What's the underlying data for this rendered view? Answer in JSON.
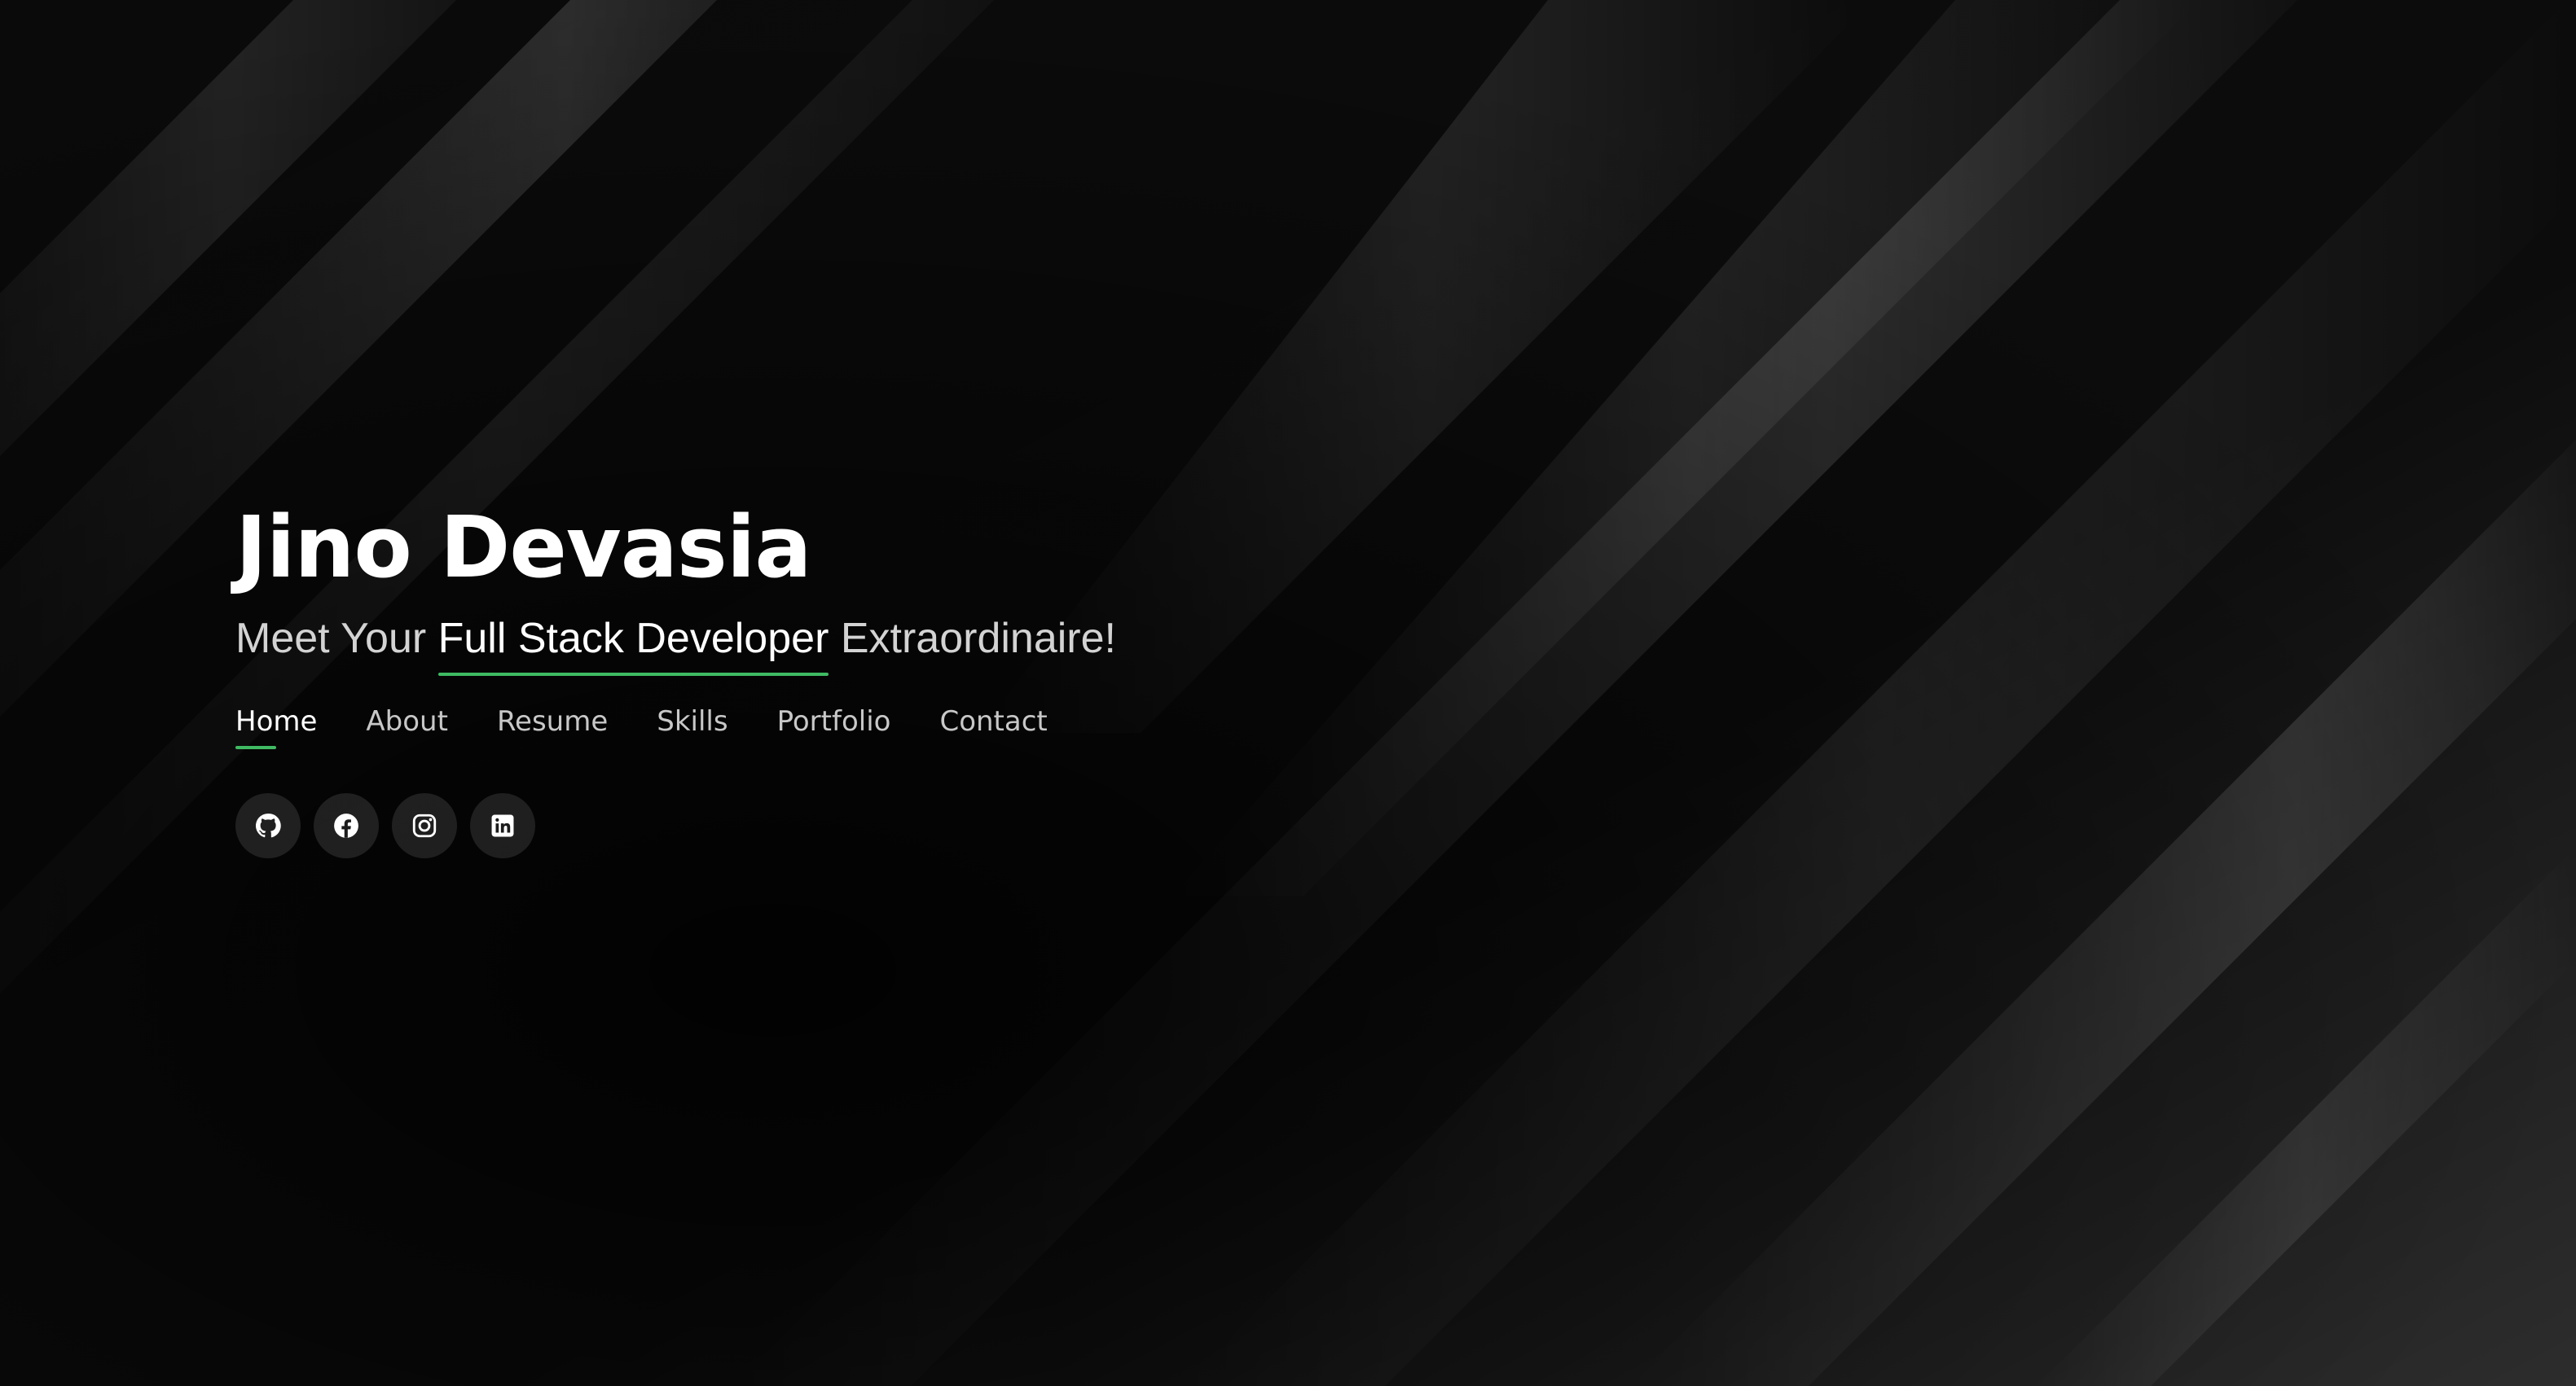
{
  "hero": {
    "name": "Jino Devasia",
    "tagline_prefix": "Meet Your ",
    "tagline_highlight": "Full Stack Developer",
    "tagline_suffix": " Extraordinaire!"
  },
  "nav": {
    "items": [
      {
        "label": "Home",
        "active": true
      },
      {
        "label": "About",
        "active": false
      },
      {
        "label": "Resume",
        "active": false
      },
      {
        "label": "Skills",
        "active": false
      },
      {
        "label": "Portfolio",
        "active": false
      },
      {
        "label": "Contact",
        "active": false
      }
    ]
  },
  "social": {
    "icons": [
      "github-icon",
      "facebook-icon",
      "instagram-icon",
      "linkedin-icon"
    ]
  },
  "colors": {
    "accent": "#3fba63",
    "background": "#040404",
    "text_primary": "#ffffff",
    "text_secondary": "#c8c8c8"
  }
}
